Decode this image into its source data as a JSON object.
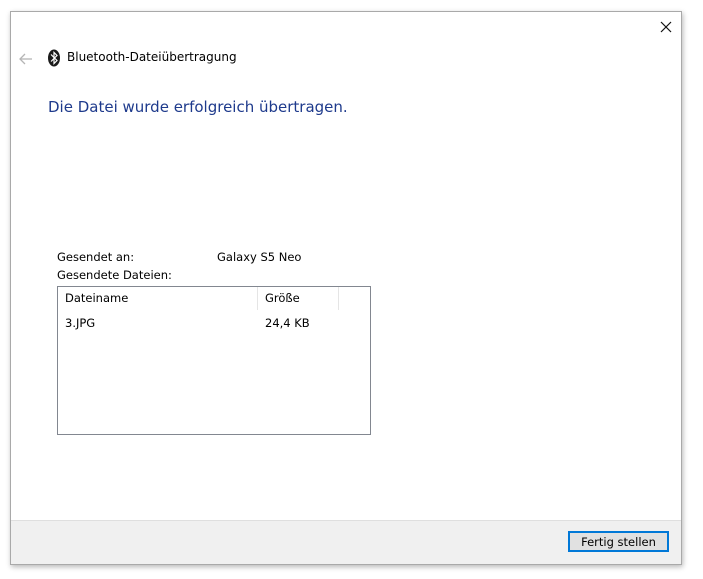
{
  "window": {
    "title": "Bluetooth-Dateiübertragung",
    "close_icon": "close-icon",
    "back_icon": "back-arrow-icon",
    "bluetooth_icon": "bluetooth-icon"
  },
  "main": {
    "heading": "Die Datei wurde erfolgreich übertragen.",
    "sent_to_label": "Gesendet an:",
    "sent_to_value": "Galaxy S5 Neo",
    "sent_files_label": "Gesendete Dateien:"
  },
  "files_table": {
    "columns": [
      "Dateiname",
      "Größe"
    ],
    "rows": [
      {
        "name": "3.JPG",
        "size": "24,4 KB"
      }
    ]
  },
  "footer": {
    "finish_label": "Fertig stellen"
  },
  "colors": {
    "heading": "#1e3a8c",
    "accent": "#0078d7",
    "footer_bg": "#f0f0f0"
  }
}
